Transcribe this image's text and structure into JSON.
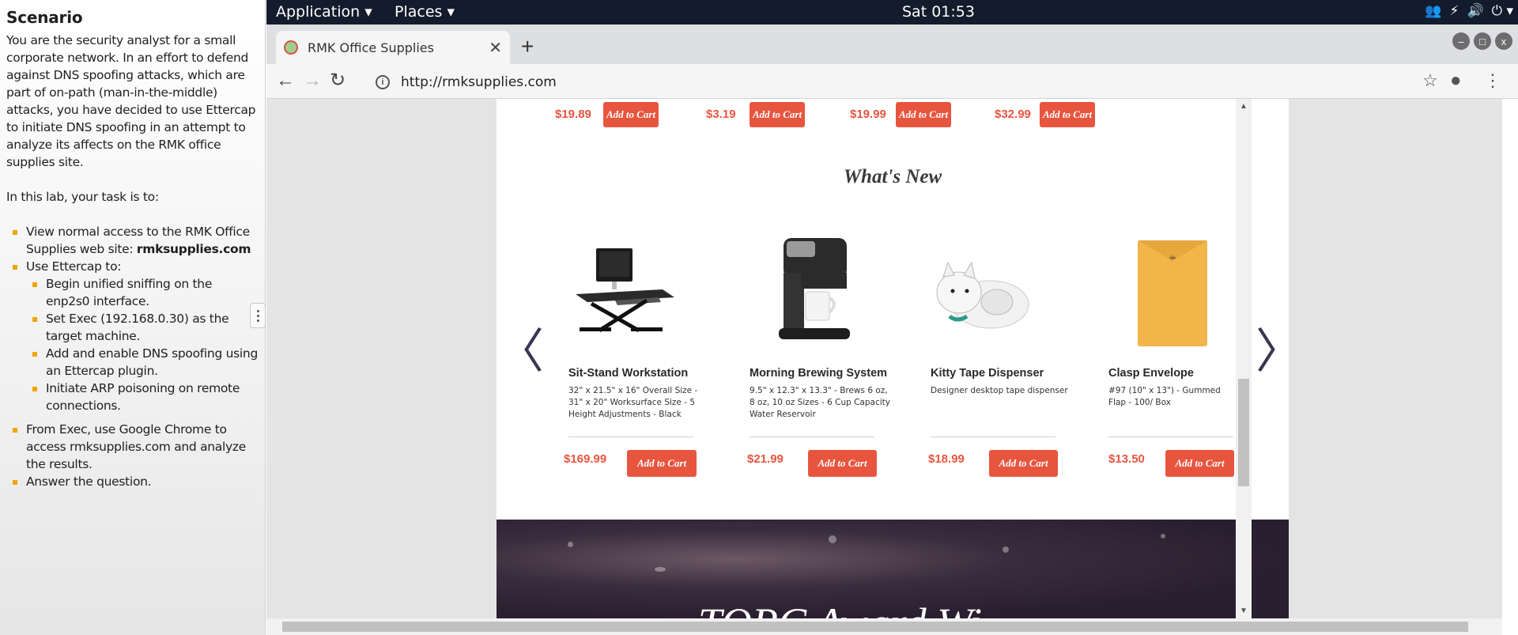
{
  "scenario": {
    "title": "Scenario",
    "intro": "You are the security analyst for a small corporate network. In an effort to defend against DNS spoofing attacks, which are part of on-path (man-in-the-middle) attacks, you have decided to use Ettercap to initiate DNS spoofing in an attempt to analyze its affects on the RMK office supplies site.",
    "task_intro": "In this lab, your task is to:",
    "task1_prefix": "View normal access to the RMK Office Supplies web site: ",
    "task1_site": "rmksupplies.com",
    "task2": "Use Ettercap to:",
    "sub1": "Begin unified sniffing on the enp2s0 interface.",
    "sub2": "Set Exec (192.168.0.30) as the target machine.",
    "sub3": "Add and enable DNS spoofing using an Ettercap plugin.",
    "sub4": "Initiate ARP poisoning on remote connections.",
    "task3": "From Exec, use Google Chrome to access rmksupplies.com and analyze the results.",
    "task4": "Answer the question."
  },
  "desktop": {
    "menu_application": "Application ▾",
    "menu_places": "Places ▾",
    "clock": "Sat 01:53"
  },
  "browser": {
    "tab_title": "RMK Office Supplies",
    "url": "http://rmksupplies.com"
  },
  "page": {
    "add_to_cart": "Add to Cart",
    "top_prices": [
      "$19.89",
      "$3.19",
      "$19.99",
      "$32.99"
    ],
    "section_title": "What's New",
    "products": [
      {
        "name": "Sit-Stand Workstation",
        "desc": "32\" x 21.5\" x 16\" Overall Size - 31\" x 20\" Worksurface Size - 5 Height Adjustments - Black",
        "price": "$169.99"
      },
      {
        "name": "Morning Brewing System",
        "desc": "9.5\" x 12.3\" x 13.3\" - Brews 6 oz, 8 oz, 10 oz Sizes - 6 Cup Capacity Water Reservoir",
        "price": "$21.99"
      },
      {
        "name": "Kitty Tape Dispenser",
        "desc": "Designer desktop tape dispenser",
        "price": "$18.99"
      },
      {
        "name": "Clasp Envelope",
        "desc": "#97 (10\" x 13\") - Gummed Flap - 100/ Box",
        "price": "$13.50"
      }
    ],
    "banner_heading": "TOPC Award Wi"
  }
}
